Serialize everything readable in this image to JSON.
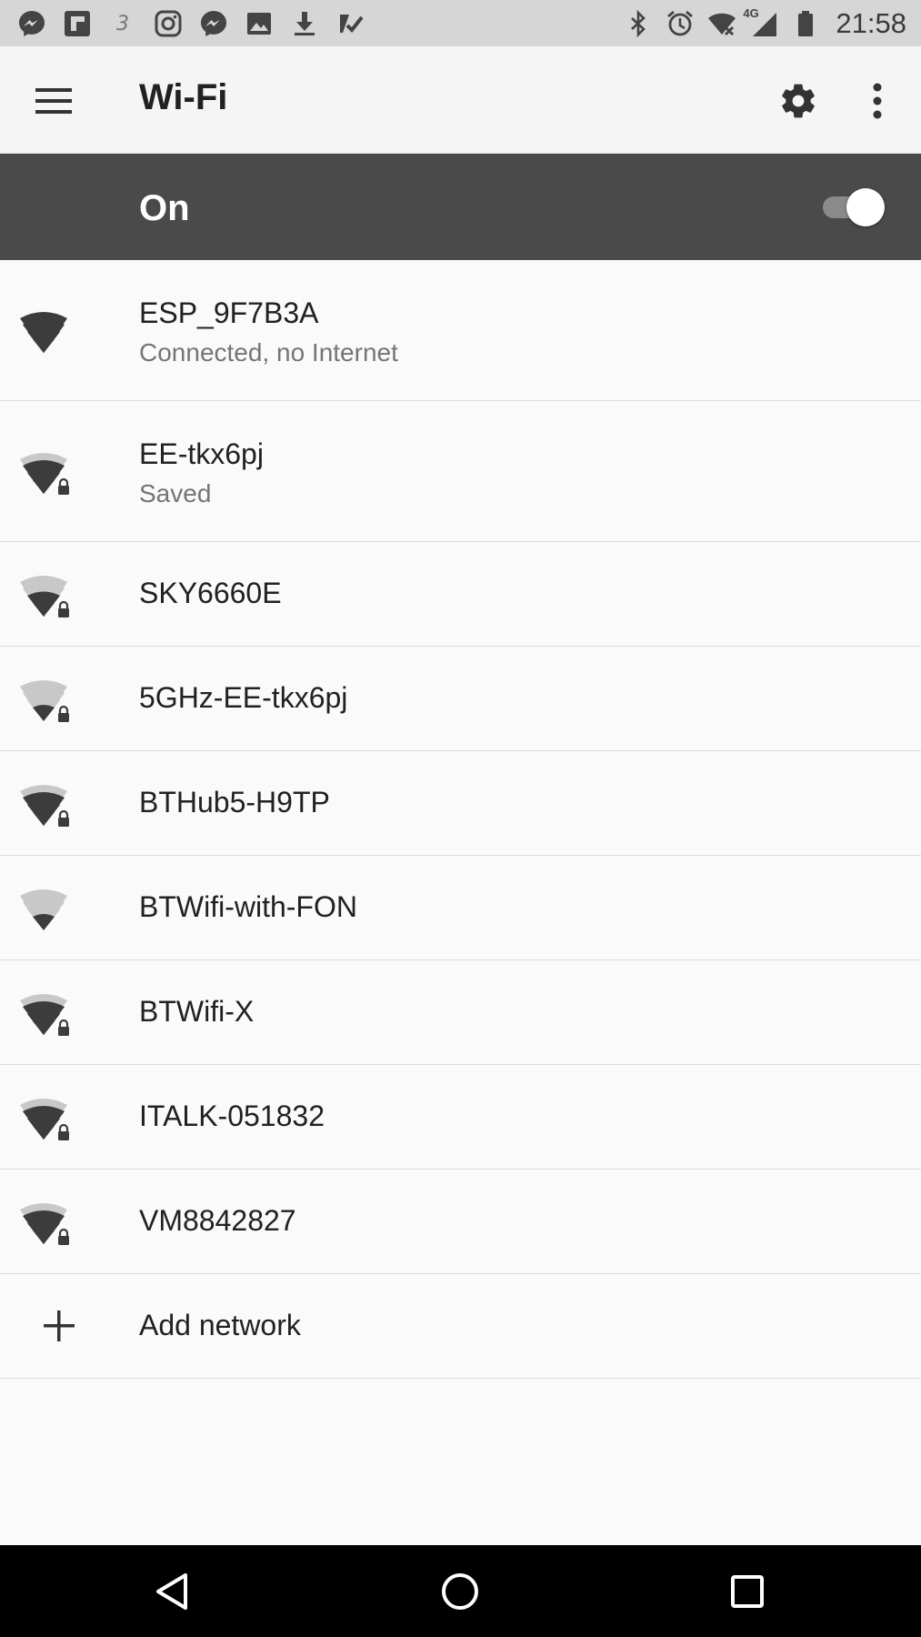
{
  "status_bar": {
    "time": "21:58",
    "network_type": "4G",
    "notification_icons": [
      "messenger-icon",
      "flipboard-icon",
      "three-icon",
      "instagram-icon",
      "messenger-icon",
      "image-icon",
      "download-icon",
      "checklist-icon"
    ],
    "system_icons": [
      "bluetooth-icon",
      "alarm-icon",
      "wifi-no-internet-icon",
      "cell-signal-icon",
      "battery-icon"
    ]
  },
  "app_bar": {
    "title": "Wi-Fi",
    "menu_icon": "hamburger-menu-icon",
    "settings_icon": "gear-icon",
    "more_icon": "more-vert-icon"
  },
  "master_switch": {
    "label": "On",
    "checked": true
  },
  "networks": [
    {
      "name": "ESP_9F7B3A",
      "status": "Connected, no Internet",
      "signal_bars": 4,
      "secured": false
    },
    {
      "name": "EE-tkx6pj",
      "status": "Saved",
      "signal_bars": 3,
      "secured": true
    },
    {
      "name": "SKY6660E",
      "status": "",
      "signal_bars": 2,
      "secured": true
    },
    {
      "name": "5GHz-EE-tkx6pj",
      "status": "",
      "signal_bars": 1,
      "secured": true
    },
    {
      "name": "BTHub5-H9TP",
      "status": "",
      "signal_bars": 3,
      "secured": true
    },
    {
      "name": "BTWifi-with-FON",
      "status": "",
      "signal_bars": 1,
      "secured": false
    },
    {
      "name": "BTWifi-X",
      "status": "",
      "signal_bars": 3,
      "secured": true
    },
    {
      "name": "ITALK-051832",
      "status": "",
      "signal_bars": 3,
      "secured": true
    },
    {
      "name": "VM8842827",
      "status": "",
      "signal_bars": 3,
      "secured": true
    }
  ],
  "add_network": {
    "label": "Add network",
    "icon": "plus-icon"
  },
  "nav_bar": {
    "back_icon": "back-triangle-icon",
    "home_icon": "home-circle-icon",
    "recents_icon": "recents-square-icon"
  },
  "colors": {
    "status_bar_bg": "#d6d6d6",
    "app_bar_bg": "#f5f5f5",
    "switch_bar_bg": "#4a4a4a",
    "list_bg": "#fafafa",
    "wifi_active": "#3c3c3c",
    "wifi_inactive": "#c8c8c8",
    "nav_bar_bg": "#000000"
  }
}
